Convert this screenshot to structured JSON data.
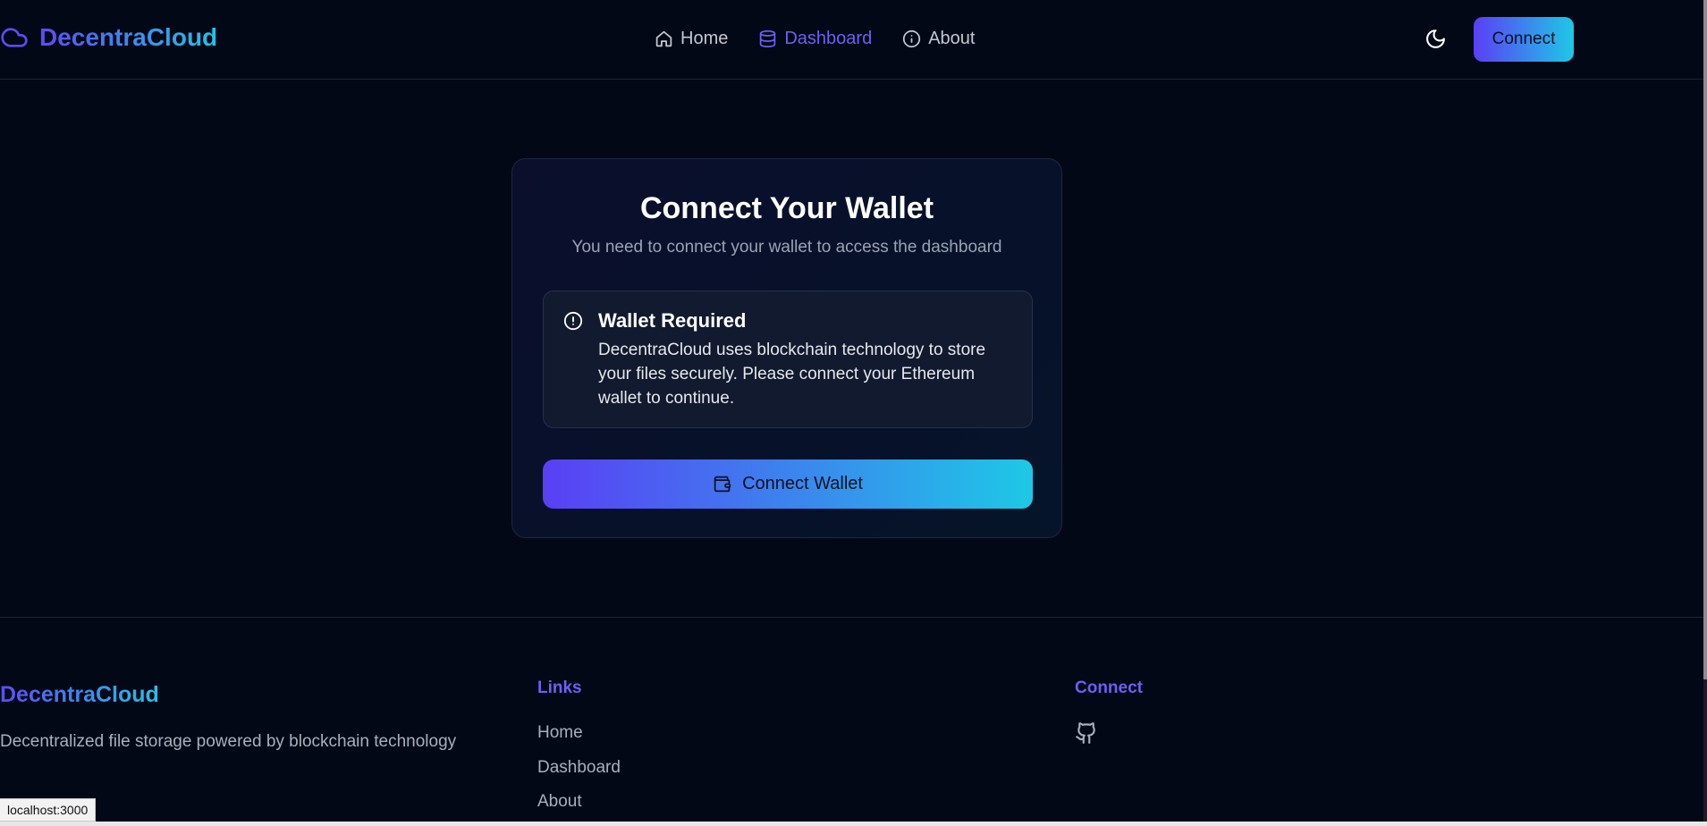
{
  "header": {
    "brand": "DecentraCloud",
    "nav": [
      {
        "label": "Home",
        "icon": "home-icon"
      },
      {
        "label": "Dashboard",
        "icon": "database-icon",
        "active": true
      },
      {
        "label": "About",
        "icon": "info-icon"
      }
    ],
    "theme_icon": "moon-icon",
    "connect_label": "Connect"
  },
  "card": {
    "title": "Connect Your Wallet",
    "subtitle": "You need to connect your wallet to access the dashboard",
    "alert": {
      "icon": "alert-circle-icon",
      "title": "Wallet Required",
      "body": "DecentraCloud uses blockchain technology to store your files securely. Please connect your Ethereum wallet to continue."
    },
    "button_label": "Connect Wallet",
    "button_icon": "wallet-icon"
  },
  "footer": {
    "brand": "DecentraCloud",
    "tagline": "Decentralized file storage powered by blockchain technology",
    "links_title": "Links",
    "links": [
      "Home",
      "Dashboard",
      "About"
    ],
    "connect_title": "Connect",
    "social_icon": "github-icon"
  },
  "status_url": "localhost:3000",
  "colors": {
    "background": "#030817",
    "accent": "#6d5ff2",
    "gradient_start": "#5a3ff5",
    "gradient_end": "#1ec8e6"
  }
}
